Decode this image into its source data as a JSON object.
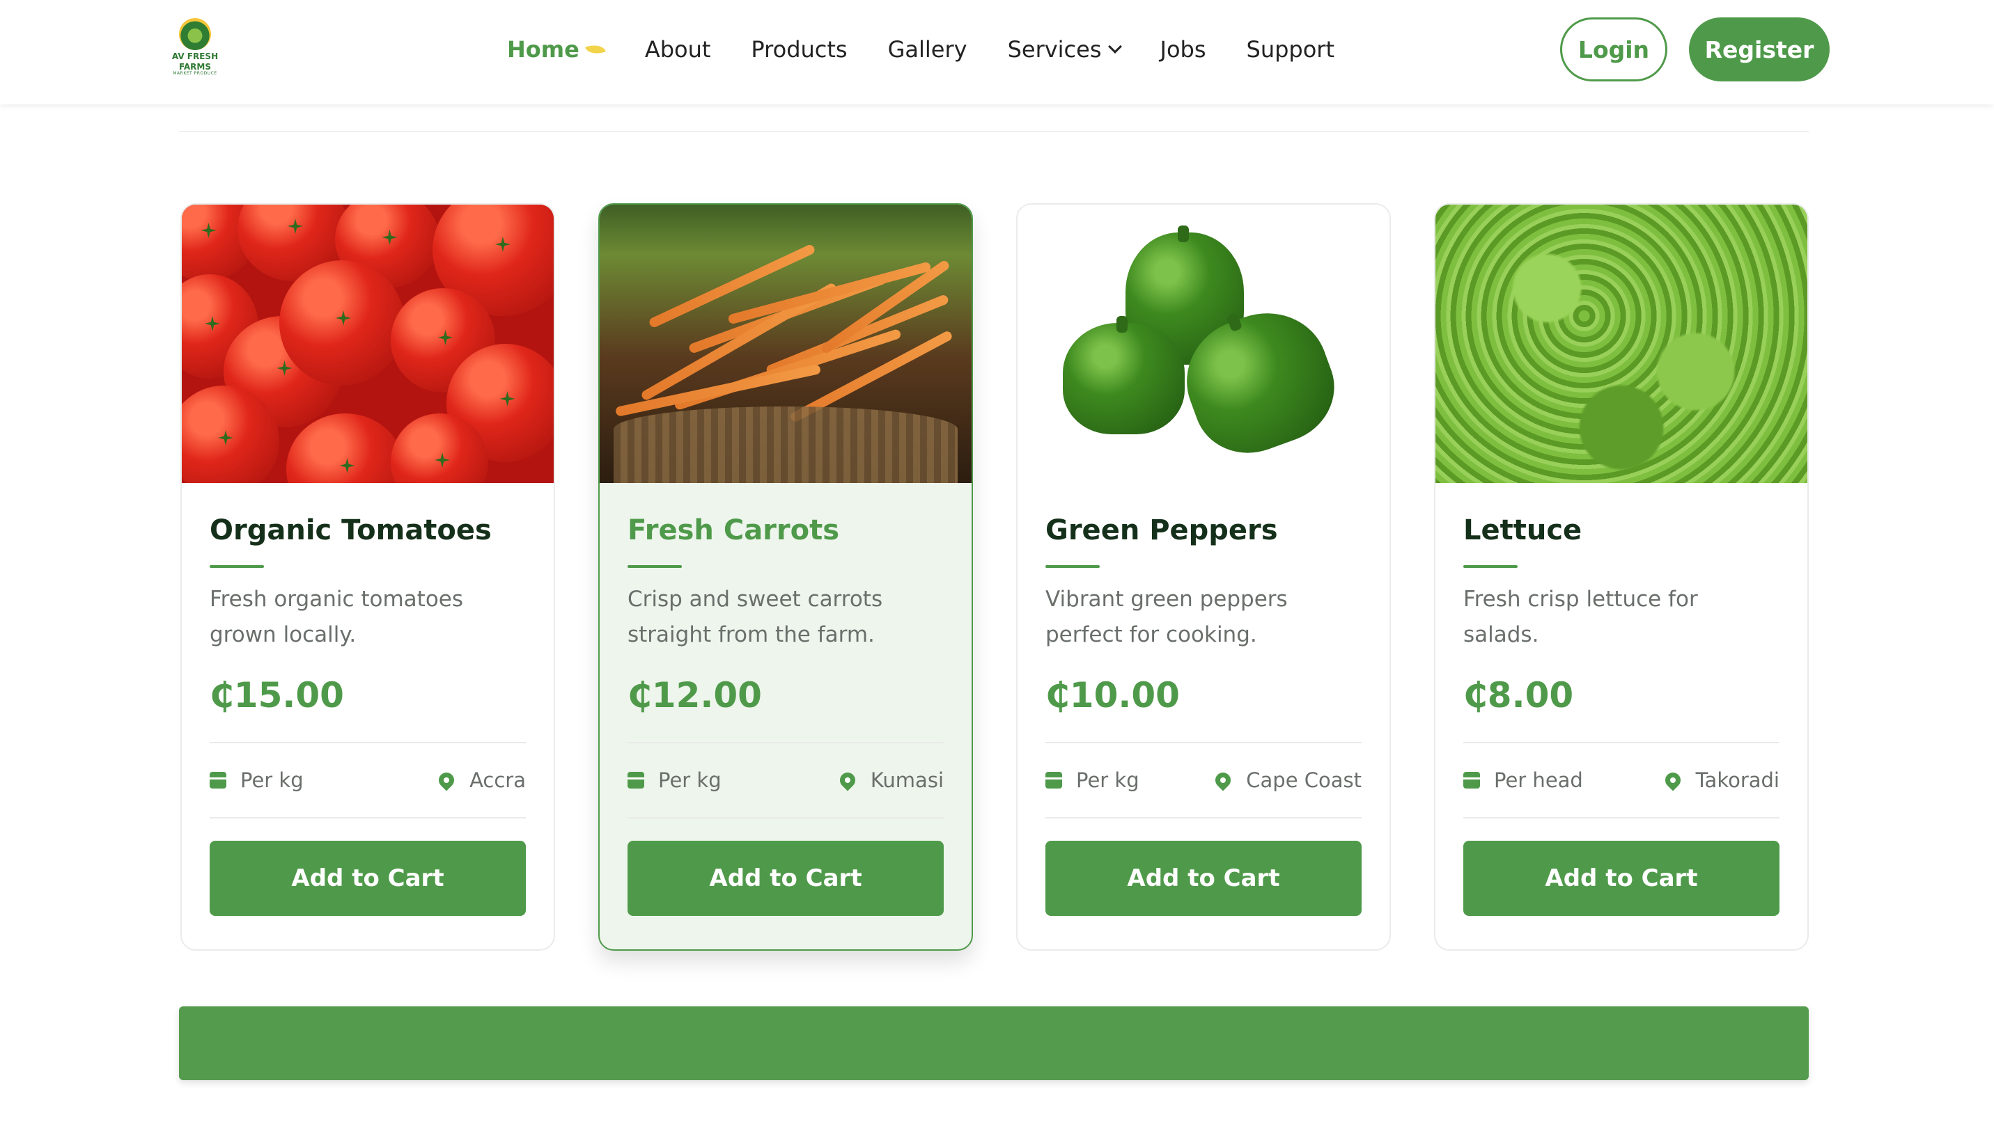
{
  "brand": {
    "logo_line1": "AV FRESH",
    "logo_line2": "FARMS",
    "logo_sub": "MARKET PRODUCE"
  },
  "nav": {
    "home": "Home",
    "about": "About",
    "products": "Products",
    "gallery": "Gallery",
    "services": "Services",
    "jobs": "Jobs",
    "support": "Support"
  },
  "auth": {
    "login": "Login",
    "register": "Register"
  },
  "colors": {
    "accent": "#4f9a4a",
    "title_dark": "#15301a",
    "featured_bg": "#eef5ec"
  },
  "products": [
    {
      "title": "Organic Tomatoes",
      "desc": "Fresh organic tomatoes grown locally.",
      "price": "₵15.00",
      "unit": "Per kg",
      "location": "Accra",
      "cta": "Add to Cart"
    },
    {
      "title": "Fresh Carrots",
      "desc": "Crisp and sweet carrots straight from the farm.",
      "price": "₵12.00",
      "unit": "Per kg",
      "location": "Kumasi",
      "cta": "Add to Cart"
    },
    {
      "title": "Green Peppers",
      "desc": "Vibrant green peppers perfect for cooking.",
      "price": "₵10.00",
      "unit": "Per kg",
      "location": "Cape Coast",
      "cta": "Add to Cart"
    },
    {
      "title": "Lettuce",
      "desc": "Fresh crisp lettuce for salads.",
      "price": "₵8.00",
      "unit": "Per head",
      "location": "Takoradi",
      "cta": "Add to Cart"
    }
  ]
}
